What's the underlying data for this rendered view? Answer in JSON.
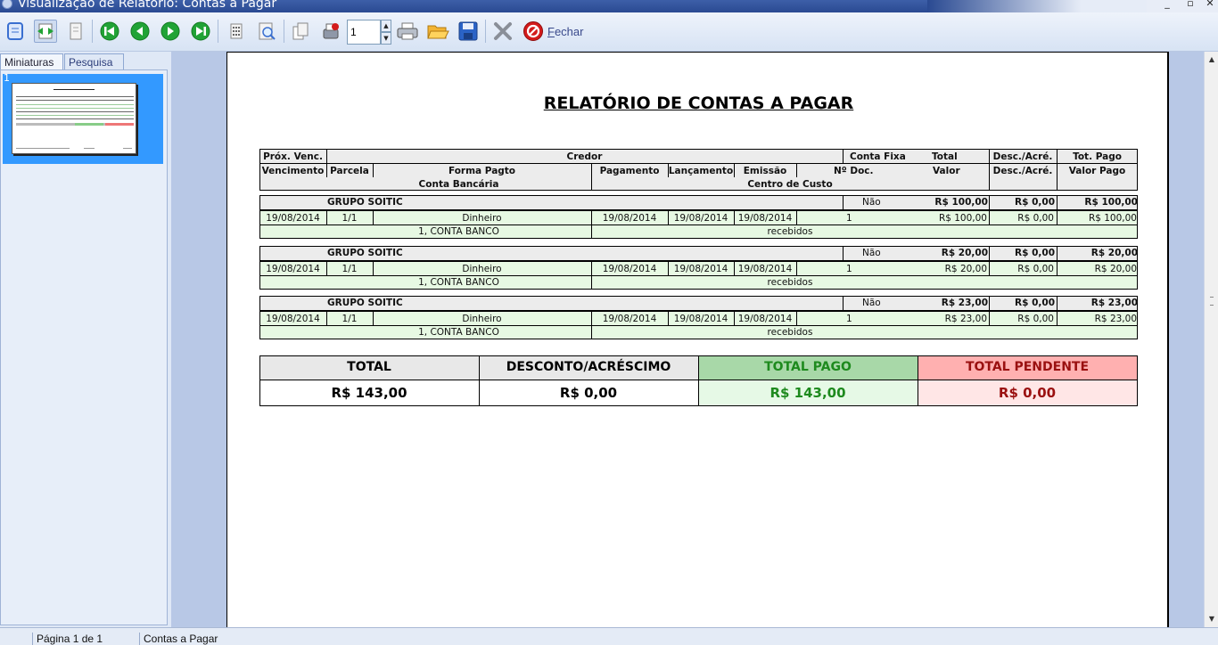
{
  "window": {
    "title": "Visualização de Relatório: Contas a Pagar",
    "controls": [
      "_",
      "▫",
      "✕"
    ]
  },
  "toolbar": {
    "page_input_value": "1",
    "close_label_prefix": "",
    "close_label_u": "F",
    "close_label_rest": "echar",
    "icons": [
      "page-icon",
      "fit-width-icon",
      "page-blank-icon",
      "first-page-icon",
      "previous-page-icon",
      "next-page-icon",
      "last-page-icon",
      "grid-icon",
      "zoom-icon",
      "copy-icon",
      "tools-icon",
      "print-icon",
      "open-folder-icon",
      "save-icon",
      "delete-icon",
      "close-icon"
    ],
    "colors": {
      "green": "#21a336",
      "blue": "#3a6fd0",
      "red": "#d31b1b"
    }
  },
  "sidebar": {
    "tabs": [
      {
        "label": "Miniaturas"
      },
      {
        "label": "Pesquisa"
      }
    ],
    "thumbnail_number": "1"
  },
  "report": {
    "title": "RELATÓRIO DE CONTAS A PAGAR",
    "header": {
      "row1": {
        "prox_venc": "Próx. Venc.",
        "credor": "Credor",
        "conta_fixa": "Conta Fixa",
        "total": "Total",
        "desc_acre": "Desc./Acré.",
        "tot_pago": "Tot. Pago"
      },
      "row2": {
        "vencimento": "Vencimento",
        "parcela": "Parcela",
        "forma_pagto": "Forma Pagto",
        "pagamento": "Pagamento",
        "lancamento": "Lançamento",
        "emissao": "Emissão",
        "n_doc": "Nº Doc.",
        "valor": "Valor",
        "desc_acre": "Desc./Acré.",
        "valor_pago": "Valor Pago"
      },
      "row3": {
        "conta_bancaria": "Conta Bancária",
        "centro_custo": "Centro de Custo"
      }
    },
    "groups": [
      {
        "credor": "GRUPO SOITIC",
        "conta_fixa": "Não",
        "total": "R$ 100,00",
        "desc": "R$ 0,00",
        "pago": "R$ 100,00",
        "venc": "19/08/2014",
        "parcela": "1/1",
        "forma": "Dinheiro",
        "pagamento": "19/08/2014",
        "lancamento": "19/08/2014",
        "emissao": "19/08/2014",
        "doc": "1",
        "valor": "R$ 100,00",
        "desc2": "R$ 0,00",
        "valor_pago": "R$ 100,00",
        "conta": "1, CONTA BANCO",
        "centro": "recebidos"
      },
      {
        "credor": "GRUPO SOITIC",
        "conta_fixa": "Não",
        "total": "R$ 20,00",
        "desc": "R$ 0,00",
        "pago": "R$ 20,00",
        "venc": "19/08/2014",
        "parcela": "1/1",
        "forma": "Dinheiro",
        "pagamento": "19/08/2014",
        "lancamento": "19/08/2014",
        "emissao": "19/08/2014",
        "doc": "1",
        "valor": "R$ 20,00",
        "desc2": "R$ 0,00",
        "valor_pago": "R$ 20,00",
        "conta": "1, CONTA BANCO",
        "centro": "recebidos"
      },
      {
        "credor": "GRUPO SOITIC",
        "conta_fixa": "Não",
        "total": "R$ 23,00",
        "desc": "R$ 0,00",
        "pago": "R$ 23,00",
        "venc": "19/08/2014",
        "parcela": "1/1",
        "forma": "Dinheiro",
        "pagamento": "19/08/2014",
        "lancamento": "19/08/2014",
        "emissao": "19/08/2014",
        "doc": "1",
        "valor": "R$ 23,00",
        "desc2": "R$ 0,00",
        "valor_pago": "R$ 23,00",
        "conta": "1, CONTA BANCO",
        "centro": "recebidos"
      }
    ],
    "summary": [
      {
        "label": "TOTAL",
        "value": "R$ 143,00",
        "head_bg": "#e8e8e8",
        "val_bg": "#ffffff",
        "color": "#000000"
      },
      {
        "label": "DESCONTO/ACRÉSCIMO",
        "value": "R$ 0,00",
        "head_bg": "#e8e8e8",
        "val_bg": "#ffffff",
        "color": "#000000"
      },
      {
        "label": "TOTAL PAGO",
        "value": "R$ 143,00",
        "head_bg": "#a8d8a8",
        "val_bg": "#e6f9e6",
        "color": "#1e8a1e"
      },
      {
        "label": "TOTAL PENDENTE",
        "value": "R$ 0,00",
        "head_bg": "#ffb0b0",
        "val_bg": "#ffe6e6",
        "color": "#9a1010"
      }
    ]
  },
  "statusbar": {
    "cells": [
      "",
      "Página 1 de 1",
      "Contas a Pagar"
    ]
  }
}
